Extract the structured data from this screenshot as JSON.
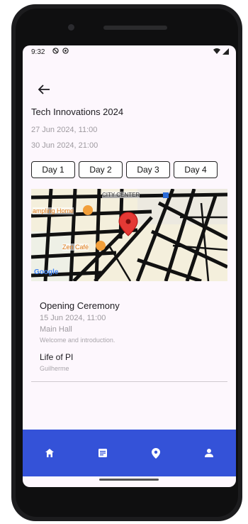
{
  "status": {
    "time": "9:32"
  },
  "event": {
    "title": "Tech Innovations 2024",
    "start": "27 Jun 2024, 11:00",
    "end": "30 Jun 2024, 21:00"
  },
  "days": [
    "Day 1",
    "Day 2",
    "Day 3",
    "Day 4"
  ],
  "map": {
    "labels": {
      "poi1": "ampling Home",
      "poi2": "Zen Café",
      "center": "CITY CENTER",
      "google": "Google"
    },
    "colors": {
      "road": "#111111",
      "block": "#f4efdc",
      "pin": "#e53935"
    }
  },
  "session": {
    "title": "Opening Ceremony",
    "datetime": "15 Jun 2024, 11:00",
    "room": "Main Hall",
    "description": "Welcome and introduction."
  },
  "talk": {
    "title": "Life of PI",
    "speaker": "Guilherme"
  },
  "nav": {
    "color": "#3452d8",
    "items": [
      {
        "name": "home-icon"
      },
      {
        "name": "schedule-icon"
      },
      {
        "name": "location-icon"
      },
      {
        "name": "person-icon"
      }
    ]
  }
}
